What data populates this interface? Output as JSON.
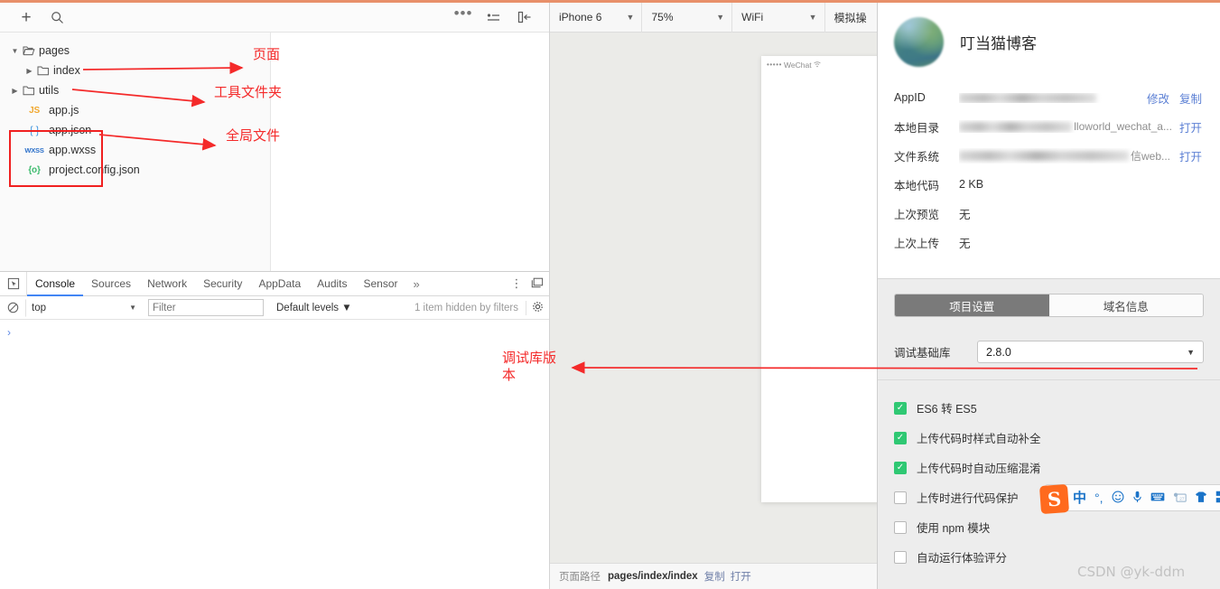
{
  "file_toolbar": {
    "add_icon": "plus-icon",
    "search_icon": "search-icon",
    "more_icon": "ellipsis-icon",
    "sort_icon": "sort-list-icon",
    "collapse_icon": "collapse-panel-icon"
  },
  "file_tree": [
    {
      "label": "pages",
      "indent": 1,
      "type": "folder",
      "expanded": true,
      "icon": "folder-open-icon"
    },
    {
      "label": "index",
      "indent": 2,
      "type": "folder",
      "expanded": false,
      "icon": "folder-icon"
    },
    {
      "label": "utils",
      "indent": 1,
      "type": "folder",
      "expanded": false,
      "icon": "folder-icon"
    },
    {
      "label": "app.js",
      "indent": 2,
      "type": "file",
      "icon": "js-file-icon",
      "icon_text": "JS"
    },
    {
      "label": "app.json",
      "indent": 2,
      "type": "file",
      "icon": "json-file-icon",
      "icon_text": "{ }"
    },
    {
      "label": "app.wxss",
      "indent": 2,
      "type": "file",
      "icon": "wxss-file-icon",
      "icon_text": "WXSS"
    },
    {
      "label": "project.config.json",
      "indent": 2,
      "type": "file",
      "icon": "config-file-icon",
      "icon_text": "{o}"
    }
  ],
  "annotations": [
    {
      "text": "页面",
      "name": "annotation-pages"
    },
    {
      "text": "工具文件夹",
      "name": "annotation-utils-folder"
    },
    {
      "text": "全局文件",
      "name": "annotation-global-files"
    },
    {
      "text": "调试库版本",
      "name": "annotation-debug-library-version"
    }
  ],
  "devtools": {
    "inspect_icon": "inspect-element-icon",
    "tabs": [
      {
        "label": "Console",
        "active": true
      },
      {
        "label": "Sources",
        "active": false
      },
      {
        "label": "Network",
        "active": false
      },
      {
        "label": "Security",
        "active": false
      },
      {
        "label": "AppData",
        "active": false
      },
      {
        "label": "Audits",
        "active": false
      },
      {
        "label": "Sensor",
        "active": false
      }
    ],
    "more_tabs": "»",
    "kebab_icon": "more-vertical-icon",
    "dock_icon": "dock-panel-icon",
    "clear_icon": "clear-console-icon",
    "context": "top",
    "filter_placeholder": "Filter",
    "filter_value": "",
    "levels": "Default levels",
    "hidden_notice": "1 item hidden by filters",
    "settings_icon": "gear-icon",
    "prompt": "›"
  },
  "simulator": {
    "toolbar": {
      "device": "iPhone 6",
      "zoom": "75%",
      "network": "WiFi",
      "more": "模拟操"
    },
    "phone_status": {
      "signal_dots": "•••••",
      "carrier": "WeChat",
      "wifi_icon": "wifi-icon"
    },
    "status_bar": {
      "label": "页面路径",
      "path": "pages/index/index",
      "copy": "复制",
      "open": "打开"
    }
  },
  "project": {
    "avatar": "project-avatar",
    "title": "叮当猫博客",
    "rows": [
      {
        "label": "AppID",
        "value": "",
        "blurred": true,
        "tail": "",
        "actions": [
          "修改",
          "复制"
        ]
      },
      {
        "label": "本地目录",
        "value": "",
        "blurred": true,
        "tail": "lloworld_wechat_a...",
        "actions": [
          "打开"
        ]
      },
      {
        "label": "文件系统",
        "value": "",
        "blurred": true,
        "tail": "信web...",
        "actions": [
          "打开"
        ]
      },
      {
        "label": "本地代码",
        "value": "2 KB",
        "blurred": false,
        "tail": "",
        "actions": []
      },
      {
        "label": "上次预览",
        "value": "无",
        "blurred": false,
        "tail": "",
        "actions": []
      },
      {
        "label": "上次上传",
        "value": "无",
        "blurred": false,
        "tail": "",
        "actions": []
      }
    ]
  },
  "settings": {
    "tabs": [
      {
        "label": "项目设置",
        "active": true
      },
      {
        "label": "域名信息",
        "active": false
      }
    ],
    "library": {
      "label": "调试基础库",
      "value": "2.8.0",
      "chevron": "chevron-down-icon"
    },
    "options": [
      {
        "label": "ES6 转 ES5",
        "checked": true
      },
      {
        "label": "上传代码时样式自动补全",
        "checked": true
      },
      {
        "label": "上传代码时自动压缩混淆",
        "checked": true
      },
      {
        "label": "上传时进行代码保护",
        "checked": false
      },
      {
        "label": "使用 npm 模块",
        "checked": false
      },
      {
        "label": "自动运行体验评分",
        "checked": false
      }
    ]
  },
  "ime": {
    "logo": "sogou-logo-icon",
    "logo_text": "S",
    "items": [
      {
        "glyph": "中",
        "name": "language-toggle-icon",
        "dim": false
      },
      {
        "glyph": "°,",
        "name": "punctuation-icon",
        "dim": false
      },
      {
        "glyph": "☺",
        "name": "emoji-icon",
        "dim": false
      },
      {
        "glyph": "⬤",
        "name": "microphone-icon",
        "dim": false
      },
      {
        "glyph": "⌨",
        "name": "keyboard-icon",
        "dim": false
      },
      {
        "glyph": "☰",
        "name": "calendar-icon",
        "dim": true
      },
      {
        "glyph": "⬤",
        "name": "skin-shirt-icon",
        "dim": false
      },
      {
        "glyph": "▦",
        "name": "toolbox-grid-icon",
        "dim": false
      }
    ]
  },
  "watermark": "CSDN @yk-ddm",
  "colors": {
    "accent_red": "#f42a2a",
    "link_blue": "#5b7fd4",
    "checkbox_green": "#2fc873",
    "tab_underline": "#4285f4",
    "ime_orange": "#ff6a1e",
    "top_border": "#e8906a"
  }
}
